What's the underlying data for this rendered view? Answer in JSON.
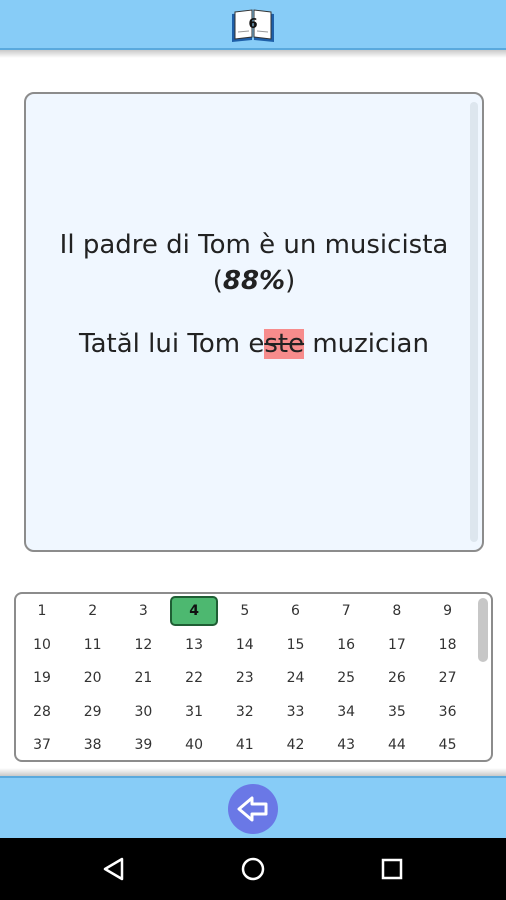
{
  "header": {
    "book_number": "6",
    "book_icon": "open-book-icon"
  },
  "card": {
    "italian_sentence_line1": "Il padre di Tom è un musicista",
    "score_open": "(",
    "score_value": "88%",
    "score_close": ")",
    "romanian_before": "Tatăl lui Tom e",
    "romanian_error": "ste",
    "romanian_after": " muzician",
    "error_highlight_color": "#f78c8c"
  },
  "grid": {
    "current": "4",
    "current_color": "#4db870",
    "numbers": [
      "1",
      "2",
      "3",
      "4",
      "5",
      "6",
      "7",
      "8",
      "9",
      "10",
      "11",
      "12",
      "13",
      "14",
      "15",
      "16",
      "17",
      "18",
      "19",
      "20",
      "21",
      "22",
      "23",
      "24",
      "25",
      "26",
      "27",
      "28",
      "29",
      "30",
      "31",
      "32",
      "33",
      "34",
      "35",
      "36",
      "37",
      "38",
      "39",
      "40",
      "41",
      "42",
      "43",
      "44",
      "45"
    ]
  },
  "footer": {
    "back_icon": "back-arrow-icon",
    "accent": "#87ccf7"
  },
  "navbar": {
    "back_icon": "nav-back-triangle-icon",
    "home_icon": "nav-home-circle-icon",
    "recents_icon": "nav-recents-square-icon"
  }
}
